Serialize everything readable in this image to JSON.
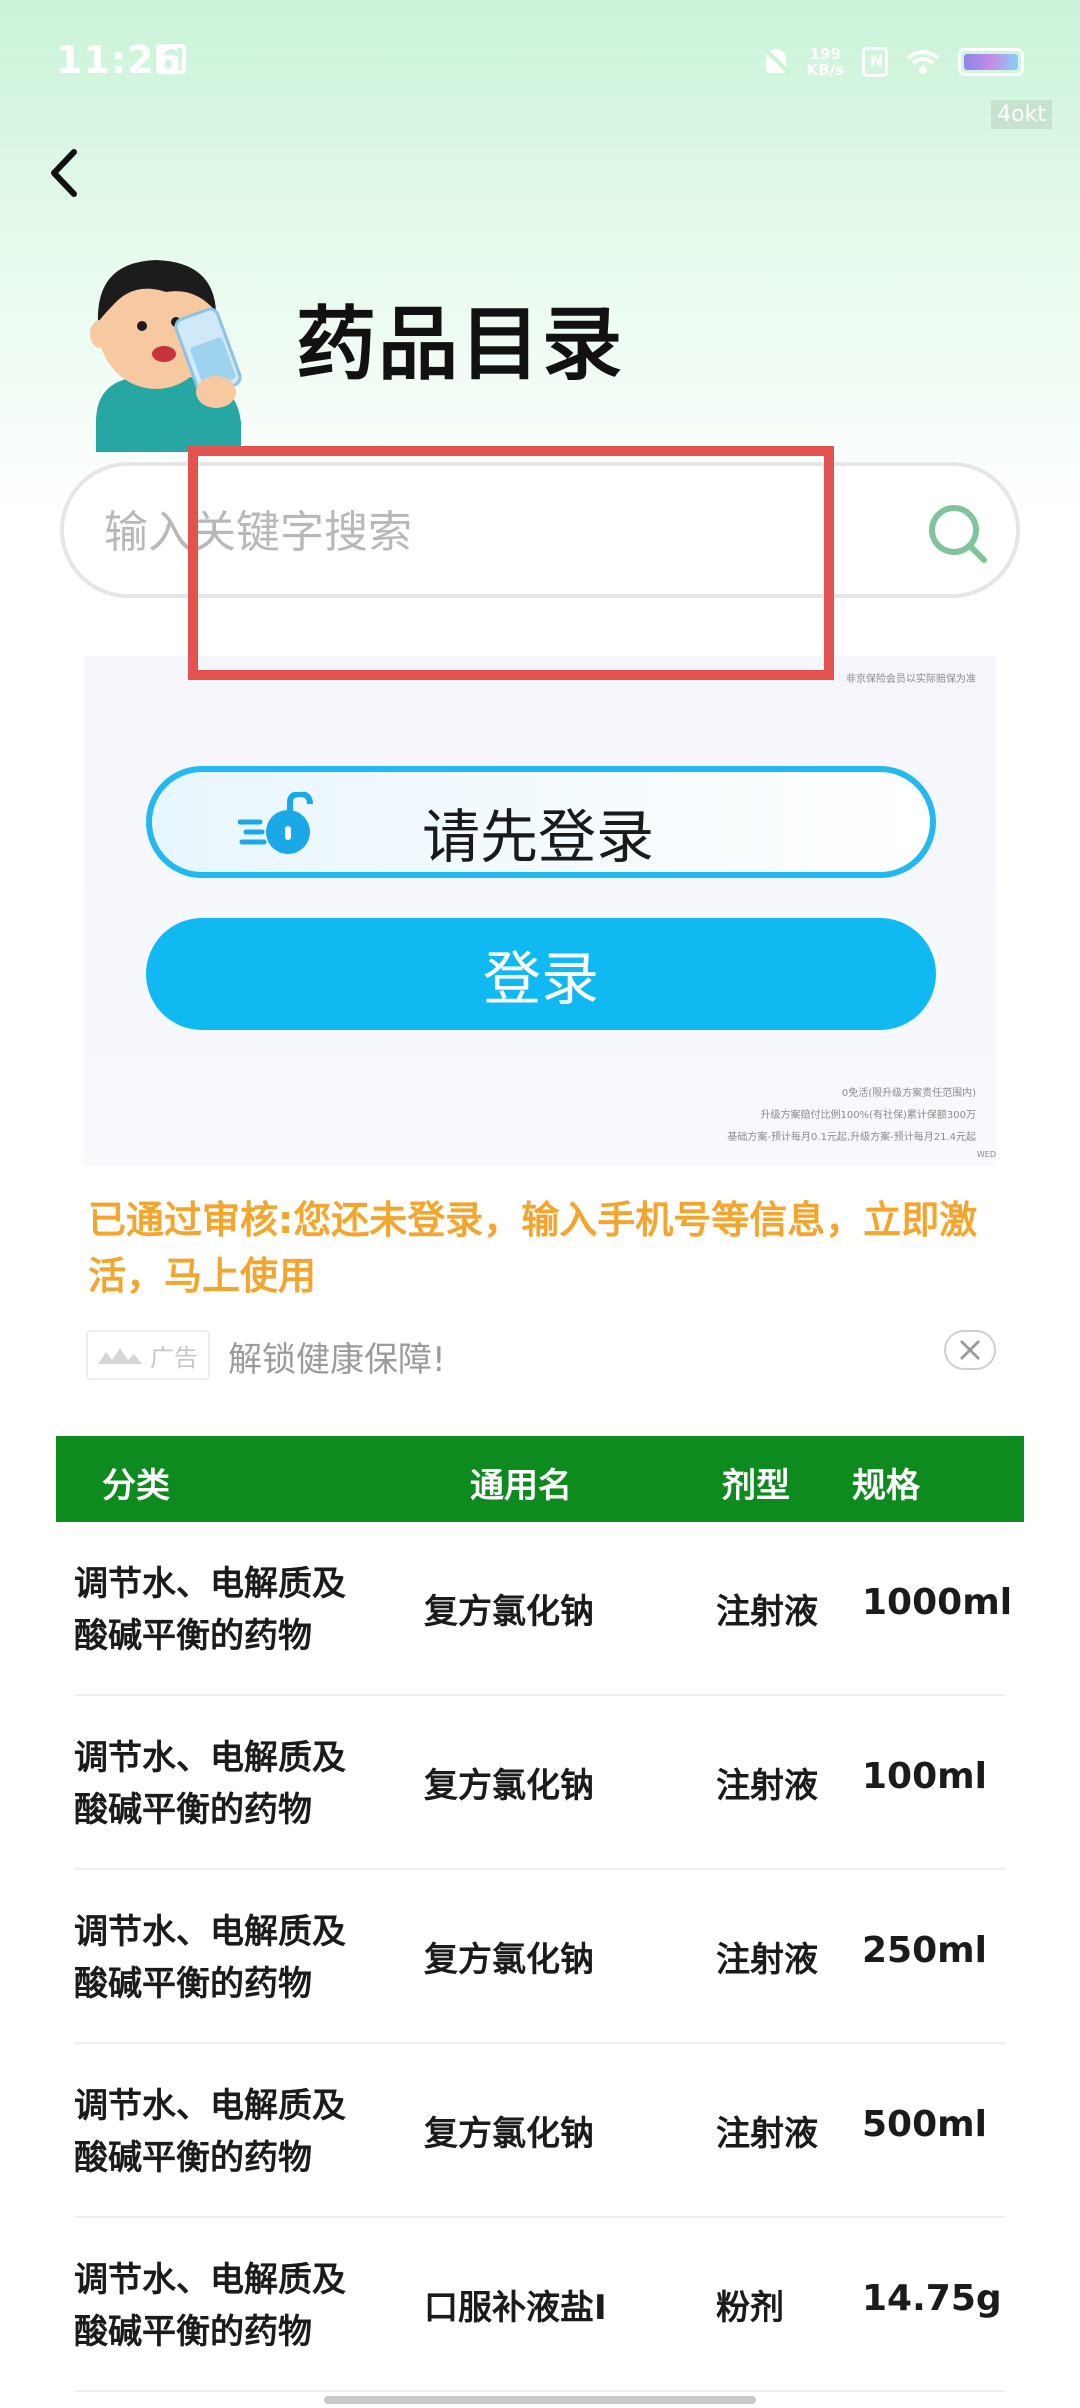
{
  "status_bar": {
    "time": "11:26",
    "net_speed_value": "199",
    "net_speed_unit": "KB/s"
  },
  "watermark": "4okt",
  "header": {
    "title": "药品目录"
  },
  "search": {
    "placeholder": "输入关键字搜索"
  },
  "ad_banner": {
    "tiny_top": "非京保险会员以实际赔保为准",
    "prompt_text": "请先登录",
    "login_label": "登录",
    "fine_print_1": "0免活(限升级方案责任范围内)",
    "fine_print_2": "升级方案赔付比例100%(有社保)累计保额300万",
    "fine_print_3": "基础方案-预计每月0.1元起,升级方案-预计每月21.4元起",
    "corner_mark": "WED"
  },
  "promo": {
    "text": "已通过审核:您还未登录，输入手机号等信息，立即激活，马上使用"
  },
  "ad_row": {
    "tag": "广告",
    "caption": "解锁健康保障!"
  },
  "table": {
    "headers": {
      "category": "分类",
      "name": "通用名",
      "form": "剂型",
      "spec": "规格"
    },
    "rows": [
      {
        "category": "调节水、电解质及酸碱平衡的药物",
        "name": "复方氯化钠",
        "form": "注射液",
        "spec": "1000ml"
      },
      {
        "category": "调节水、电解质及酸碱平衡的药物",
        "name": "复方氯化钠",
        "form": "注射液",
        "spec": "100ml"
      },
      {
        "category": "调节水、电解质及酸碱平衡的药物",
        "name": "复方氯化钠",
        "form": "注射液",
        "spec": "250ml"
      },
      {
        "category": "调节水、电解质及酸碱平衡的药物",
        "name": "复方氯化钠",
        "form": "注射液",
        "spec": "500ml"
      },
      {
        "category": "调节水、电解质及酸碱平衡的药物",
        "name": "口服补液盐Ⅰ",
        "form": "粉剂",
        "spec": "14.75g"
      }
    ]
  },
  "colors": {
    "header_green": "#0d8b1f",
    "promo_orange": "#f3a52e",
    "login_blue": "#11b9f2",
    "highlight_red": "#e2524e"
  }
}
